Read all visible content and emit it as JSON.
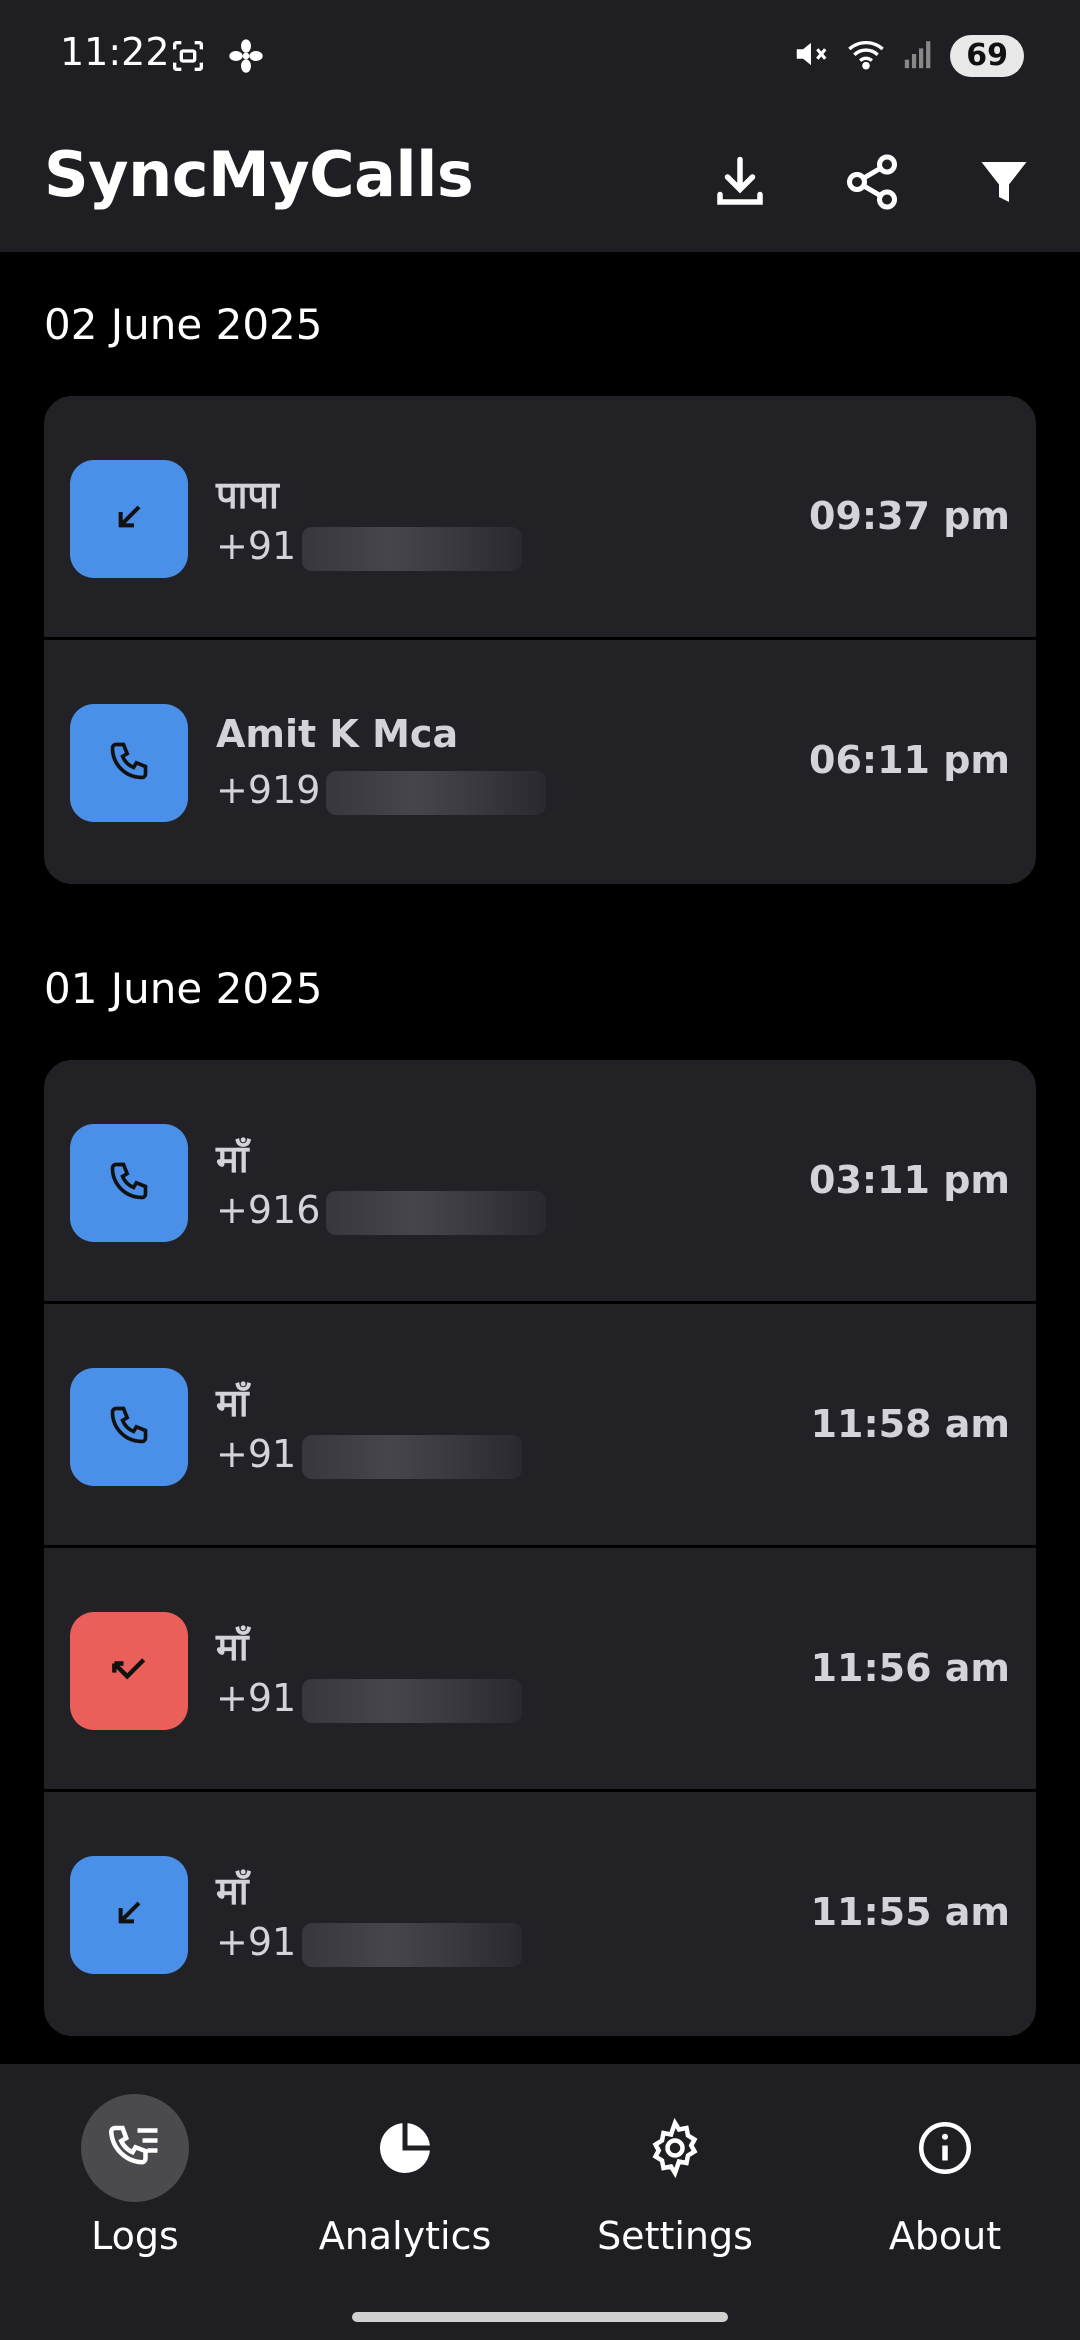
{
  "status_bar": {
    "time": "11:22",
    "icons": [
      "screenshot-icon",
      "fan-icon",
      "mute-icon",
      "wifi-icon",
      "signal-icon"
    ],
    "battery": "69"
  },
  "app_bar": {
    "title": "SyncMyCalls",
    "actions": [
      "download-icon",
      "share-icon",
      "filter-icon"
    ]
  },
  "groups": [
    {
      "date": "02 June 2025",
      "calls": [
        {
          "name": "पापा",
          "number": "+91",
          "time": "09:37 pm",
          "type": "incoming",
          "color": "#4a90e8"
        },
        {
          "name": "Amit K Mca",
          "number": "+919",
          "time": "06:11 pm",
          "type": "outgoing",
          "color": "#4a90e8"
        }
      ]
    },
    {
      "date": "01 June 2025",
      "calls": [
        {
          "name": "माँ",
          "number": "+916",
          "time": "03:11 pm",
          "type": "outgoing",
          "color": "#4a90e8"
        },
        {
          "name": "माँ",
          "number": "+91",
          "time": "11:58 am",
          "type": "outgoing",
          "color": "#4a90e8"
        },
        {
          "name": "माँ",
          "number": "+91",
          "time": "11:56 am",
          "type": "missed",
          "color": "#ea5f5a"
        },
        {
          "name": "माँ",
          "number": "+91",
          "time": "11:55 am",
          "type": "incoming",
          "color": "#4a90e8"
        }
      ]
    }
  ],
  "bottom_nav": {
    "items": [
      {
        "label": "Logs",
        "icon": "call-log-icon",
        "active": true
      },
      {
        "label": "Analytics",
        "icon": "pie-chart-icon",
        "active": false
      },
      {
        "label": "Settings",
        "icon": "gear-icon",
        "active": false
      },
      {
        "label": "About",
        "icon": "info-icon",
        "active": false
      }
    ]
  }
}
